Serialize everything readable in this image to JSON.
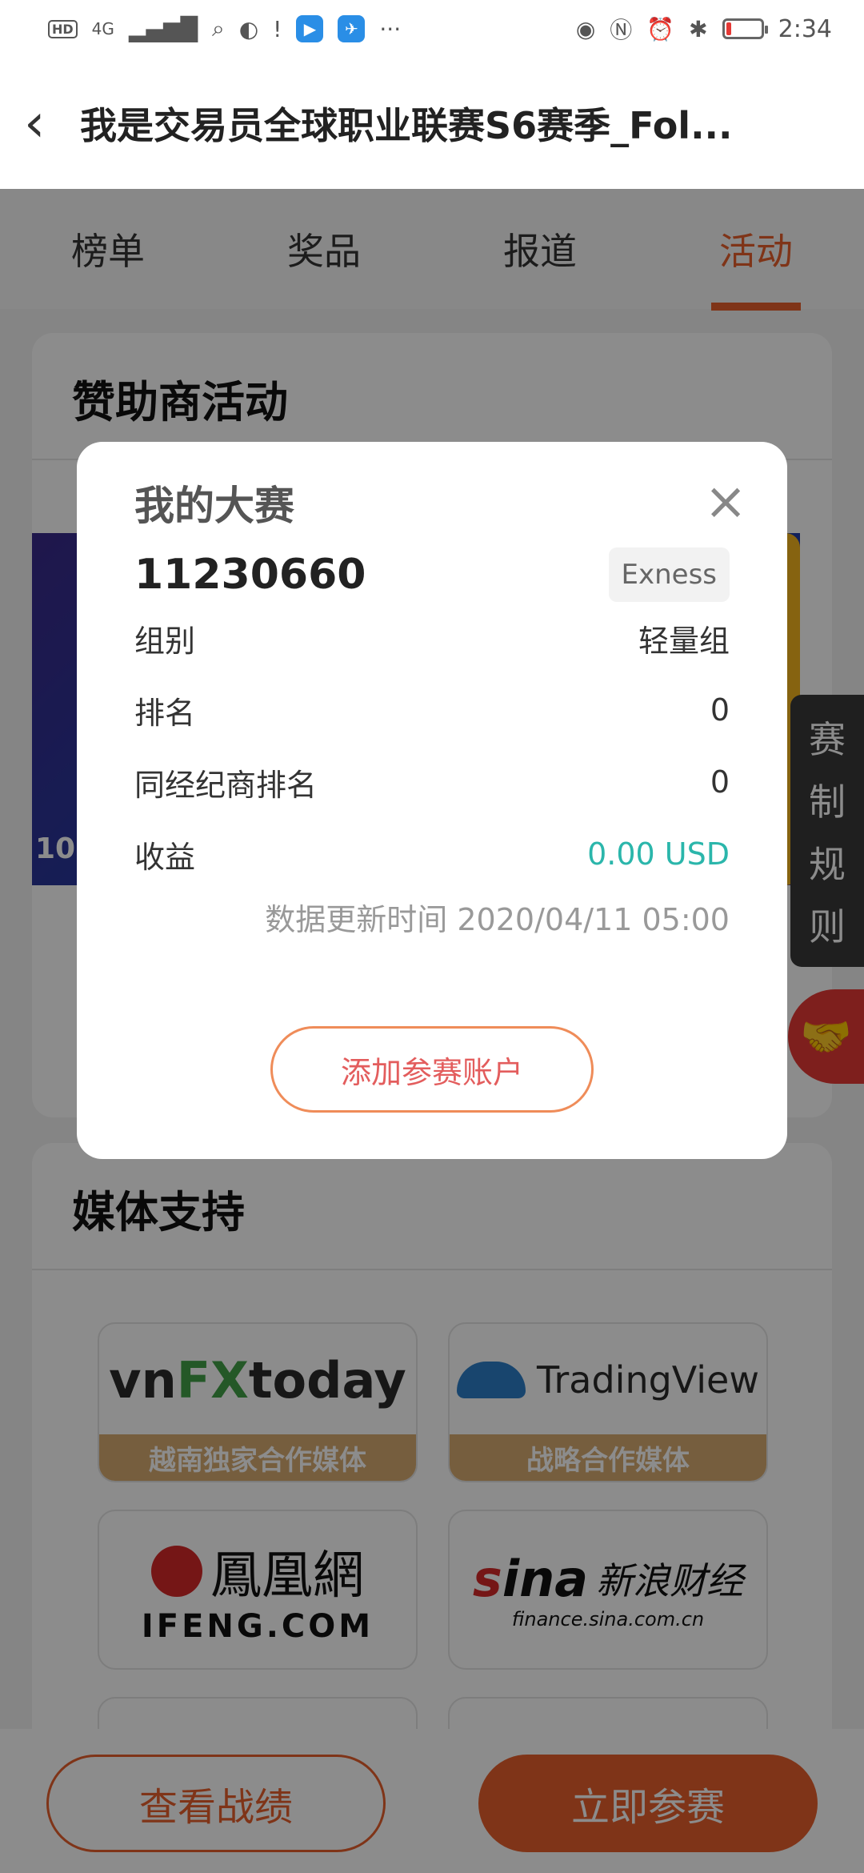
{
  "status_bar": {
    "hd": "HD",
    "network": "4G",
    "time": "2:34",
    "more": "···"
  },
  "header": {
    "title": "我是交易员全球职业联赛S6赛季_Fol..."
  },
  "tabs": [
    {
      "label": "榜单"
    },
    {
      "label": "奖品"
    },
    {
      "label": "报道"
    },
    {
      "label": "活动",
      "active": true
    }
  ],
  "sponsor_section": {
    "title": "赞助商活动",
    "banner_text": "10."
  },
  "media_section": {
    "title": "媒体支持",
    "tiles": [
      {
        "logo": "vnFXtoday",
        "logo_parts": [
          "vn",
          "FX",
          "today"
        ],
        "caption": "越南独家合作媒体"
      },
      {
        "logo": "TradingView",
        "caption": "战略合作媒体"
      },
      {
        "logo_cn": "鳳凰網",
        "logo_en": "IFENG.COM"
      },
      {
        "logo_mark": "sina",
        "logo_cn": "新浪财经",
        "logo_url": "finance.sina.com.cn"
      }
    ]
  },
  "side_tabs": {
    "rules": [
      "赛",
      "制",
      "规",
      "则"
    ],
    "handshake_icon": "handshake-icon"
  },
  "bottom": {
    "view_results": "查看战绩",
    "join_now": "立即参赛"
  },
  "modal": {
    "title": "我的大赛",
    "account": "11230660",
    "broker": "Exness",
    "rows": [
      {
        "label": "组别",
        "value": "轻量组"
      },
      {
        "label": "排名",
        "value": "0"
      },
      {
        "label": "同经纪商排名",
        "value": "0"
      },
      {
        "label": "收益",
        "value": "0.00 USD"
      }
    ],
    "update_time": "数据更新时间 2020/04/11 05:00",
    "add_account": "添加参赛账户",
    "close_icon": "close-icon"
  },
  "colors": {
    "accent": "#e8602c",
    "income": "#2bb6ab"
  }
}
